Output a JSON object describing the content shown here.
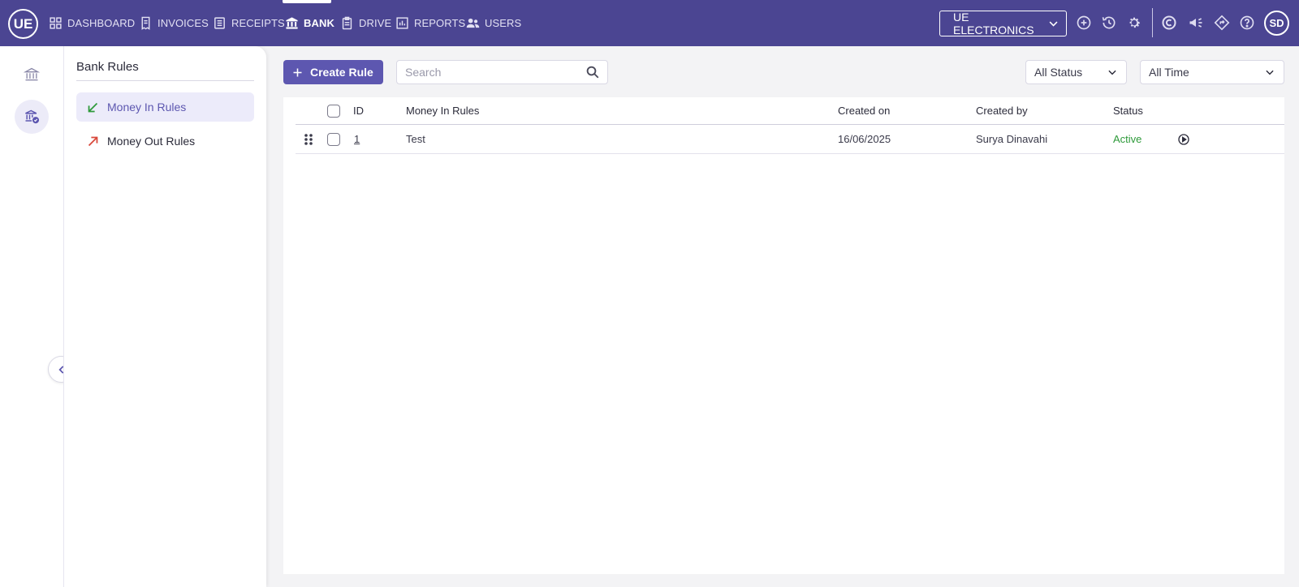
{
  "app": {
    "logo": "UE"
  },
  "nav": [
    {
      "label": "DASHBOARD",
      "icon": "dashboard-icon"
    },
    {
      "label": "INVOICES",
      "icon": "invoice-icon"
    },
    {
      "label": "RECEIPTS",
      "icon": "receipt-icon"
    },
    {
      "label": "BANK",
      "icon": "bank-icon",
      "active": true
    },
    {
      "label": "DRIVE",
      "icon": "drive-icon"
    },
    {
      "label": "REPORTS",
      "icon": "reports-icon"
    },
    {
      "label": "USERS",
      "icon": "users-icon"
    }
  ],
  "company": {
    "name": "UE ELECTRONICS"
  },
  "user": {
    "initials": "SD"
  },
  "panel": {
    "title": "Bank Rules",
    "items": [
      {
        "label": "Money In Rules",
        "selected": true
      },
      {
        "label": "Money Out Rules",
        "selected": false
      }
    ]
  },
  "toolbar": {
    "create_label": "Create Rule",
    "search_placeholder": "Search",
    "status_filter": "All Status",
    "time_filter": "All Time"
  },
  "table": {
    "columns": {
      "id": "ID",
      "name": "Money In Rules",
      "created_on": "Created on",
      "created_by": "Created by",
      "status": "Status"
    },
    "rows": [
      {
        "id": "1",
        "name": "Test",
        "created_on": "16/06/2025",
        "created_by": "Surya Dinavahi",
        "status": "Active"
      }
    ]
  },
  "colors": {
    "brand": "#4b4592",
    "accent": "#5d57b0",
    "active_status": "#2e9a3a",
    "money_in": "#2e9a3a",
    "money_out": "#d9473a"
  }
}
